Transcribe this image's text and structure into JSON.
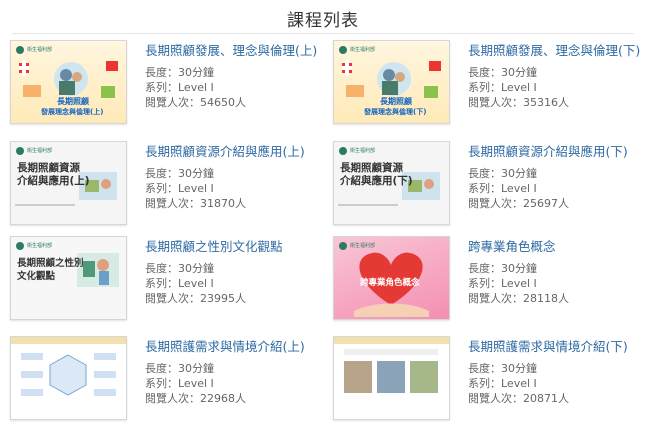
{
  "page": {
    "title": "課程列表"
  },
  "labels": {
    "length": "長度：",
    "series": "系列：",
    "views": "閱覽人次："
  },
  "courses": [
    {
      "title": "長期照顧發展、理念與倫理(上)",
      "length": "30分鐘",
      "series": "Level Ⅰ",
      "views": "54650人",
      "thumb": {
        "org": "衛生福利部",
        "line1": "長期照顧",
        "line2": "發展理念與倫理(上)"
      }
    },
    {
      "title": "長期照顧發展、理念與倫理(下)",
      "length": "30分鐘",
      "series": "Level Ⅰ",
      "views": "35316人",
      "thumb": {
        "org": "衛生福利部",
        "line1": "長期照顧",
        "line2": "發展理念與倫理(下)"
      }
    },
    {
      "title": "長期照顧資源介紹與應用(上)",
      "length": "30分鐘",
      "series": "Level Ⅰ",
      "views": "31870人",
      "thumb": {
        "org": "衛生福利部",
        "line1": "長期照顧資源",
        "line2": "介紹與應用(上)"
      }
    },
    {
      "title": "長期照顧資源介紹與應用(下)",
      "length": "30分鐘",
      "series": "Level Ⅰ",
      "views": "25697人",
      "thumb": {
        "org": "衛生福利部",
        "line1": "長期照顧資源",
        "line2": "介紹與應用(下)"
      }
    },
    {
      "title": "長期照顧之性別文化觀點",
      "length": "30分鐘",
      "series": "Level Ⅰ",
      "views": "23995人",
      "thumb": {
        "org": "衛生福利部",
        "line1": "長期照顧之性別",
        "line2": "文化觀點"
      }
    },
    {
      "title": "跨專業角色概念",
      "length": "30分鐘",
      "series": "Level Ⅰ",
      "views": "28118人",
      "thumb": {
        "org": "衛生福利部",
        "line1": "跨專業角色概念",
        "line2": ""
      }
    },
    {
      "title": "長期照護需求與情境介紹(上)",
      "length": "30分鐘",
      "series": "Level Ⅰ",
      "views": "22968人",
      "thumb": {
        "org": "",
        "line1": "",
        "line2": ""
      }
    },
    {
      "title": "長期照護需求與情境介紹(下)",
      "length": "30分鐘",
      "series": "Level Ⅰ",
      "views": "20871人",
      "thumb": {
        "org": "",
        "line1": "",
        "line2": ""
      }
    }
  ]
}
